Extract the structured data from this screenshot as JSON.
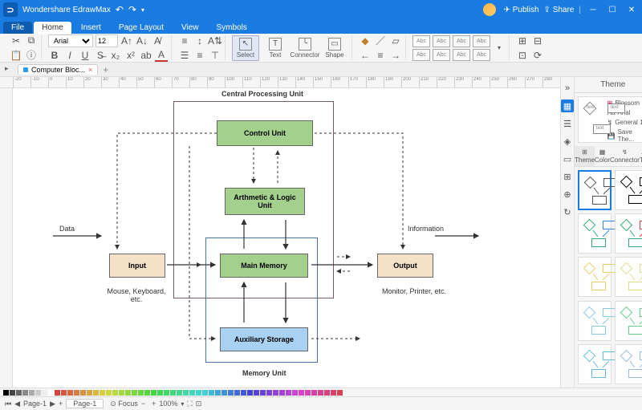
{
  "app": {
    "title": "Wondershare EdrawMax",
    "publish": "Publish",
    "share": "Share"
  },
  "menu": {
    "file": "File",
    "home": "Home",
    "insert": "Insert",
    "page_layout": "Page Layout",
    "view": "View",
    "symbols": "Symbols"
  },
  "ribbon": {
    "font": "Arial",
    "size": "12",
    "select": "Select",
    "text": "Text",
    "connector": "Connector",
    "shape": "Shape",
    "abc": "Abc"
  },
  "doc": {
    "tab": "Computer Bloc..."
  },
  "diagram": {
    "title_top": "Central Processing Unit",
    "title_bottom": "Memory Unit",
    "control_unit": "Control Unit",
    "alu": "Arthmetic & Logic Unit",
    "main_memory": "Main Memory",
    "aux_storage": "Auxiliary Storage",
    "input": "Input",
    "output": "Output",
    "data": "Data",
    "info": "Information",
    "input_caption": "Mouse, Keyboard, etc.",
    "output_caption": "Monitor, Printer, etc."
  },
  "panel": {
    "title": "Theme",
    "blossom": "Blossom",
    "arial": "Arial",
    "general": "General 1",
    "save": "Save The...",
    "tab_theme": "Theme",
    "tab_color": "Color",
    "tab_connector": "Connector",
    "tab_text": "Text",
    "textph": "text"
  },
  "status": {
    "page_label": "Page-1",
    "focus": "Focus",
    "zoom": "100%",
    "page_tab": "Page-1"
  },
  "ruler": [
    "-20",
    "-10",
    "0",
    "10",
    "20",
    "30",
    "40",
    "50",
    "60",
    "70",
    "80",
    "90",
    "100",
    "110",
    "120",
    "130",
    "140",
    "150",
    "160",
    "170",
    "180",
    "190",
    "200",
    "210",
    "220",
    "230",
    "240",
    "250",
    "260",
    "270",
    "280"
  ]
}
